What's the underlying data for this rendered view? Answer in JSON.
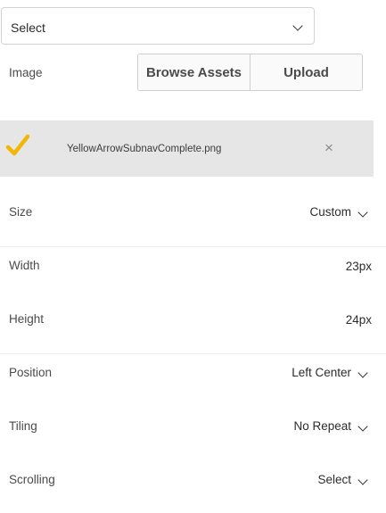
{
  "top_select": {
    "value": "Select"
  },
  "image": {
    "label": "Image",
    "browse_label": "Browse Assets",
    "upload_label": "Upload",
    "file_name": "YellowArrowSubnavComplete.png",
    "remove_symbol": "×"
  },
  "size": {
    "label": "Size",
    "value": "Custom"
  },
  "width": {
    "label": "Width",
    "value": "23px"
  },
  "height": {
    "label": "Height",
    "value": "24px"
  },
  "position": {
    "label": "Position",
    "value": "Left Center"
  },
  "tiling": {
    "label": "Tiling",
    "value": "No Repeat"
  },
  "scrolling": {
    "label": "Scrolling",
    "value": "Select"
  },
  "colors": {
    "check": "#f2b705",
    "file_row_bg": "#e6e6e6"
  },
  "icons": {
    "check": "check-icon",
    "close": "close-icon",
    "chevron": "chevron-down-icon"
  }
}
